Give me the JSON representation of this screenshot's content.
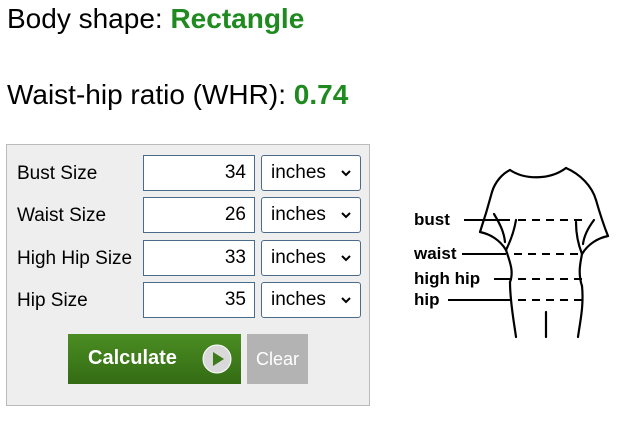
{
  "result": {
    "shape_label": "Body shape:",
    "shape_value": "Rectangle",
    "whr_label": "Waist-hip ratio (WHR):",
    "whr_value": "0.74"
  },
  "form": {
    "rows": [
      {
        "label": "Bust Size",
        "value": "34",
        "unit": "inches"
      },
      {
        "label": "Waist Size",
        "value": "26",
        "unit": "inches"
      },
      {
        "label": "High Hip Size",
        "value": "33",
        "unit": "inches"
      },
      {
        "label": "Hip Size",
        "value": "35",
        "unit": "inches"
      }
    ],
    "calculate_label": "Calculate",
    "clear_label": "Clear"
  },
  "figure": {
    "labels": {
      "bust": "bust",
      "waist": "waist",
      "high_hip": "high hip",
      "hip": "hip"
    }
  },
  "colors": {
    "result_value": "#1f8a1f",
    "calculate_button": "#3d7a1a",
    "clear_button": "#b3b3b3",
    "panel_background": "#eeeeee"
  },
  "icons": {
    "calculate": "play-circle-icon",
    "select": "chevron-down-icon"
  }
}
